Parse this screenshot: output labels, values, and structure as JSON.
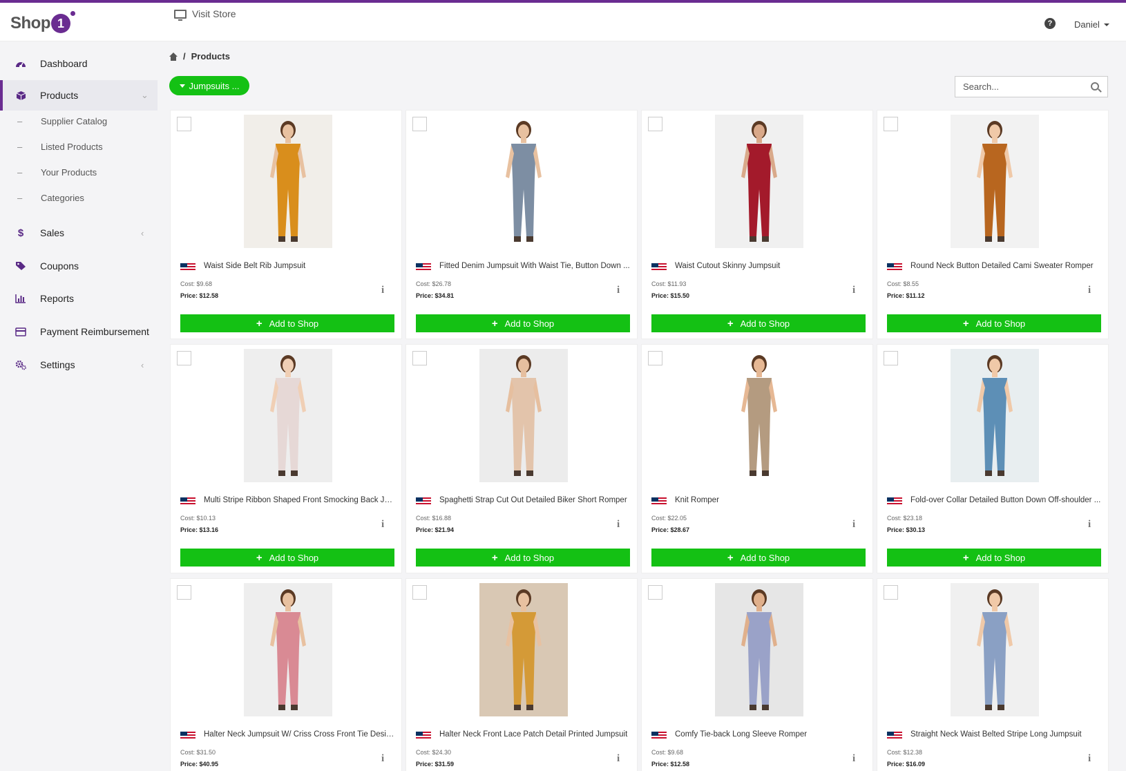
{
  "header": {
    "logo_text": "Shop",
    "logo_mark": "1",
    "visit_store": "Visit Store",
    "help": "?",
    "user": "Daniel"
  },
  "sidebar": {
    "items": [
      {
        "label": "Dashboard",
        "icon": "dashboard-icon"
      },
      {
        "label": "Products",
        "icon": "cube-icon",
        "active": true
      },
      {
        "label": "Sales",
        "icon": "dollar-icon"
      },
      {
        "label": "Coupons",
        "icon": "tag-icon"
      },
      {
        "label": "Reports",
        "icon": "bar-chart-icon"
      },
      {
        "label": "Payment Reimbursement",
        "icon": "credit-card-icon"
      },
      {
        "label": "Settings",
        "icon": "gears-icon"
      }
    ],
    "products_sub": [
      "Supplier Catalog",
      "Listed Products",
      "Your Products",
      "Categories"
    ]
  },
  "breadcrumb": {
    "separator": "/",
    "current": "Products"
  },
  "filter": {
    "label": "Jumpsuits ..."
  },
  "search": {
    "placeholder": "Search..."
  },
  "add_label": "Add to Shop",
  "info_glyph": "i",
  "colors": {
    "accent": "#6a2c91",
    "green": "#14c114"
  },
  "products": [
    {
      "name": "Waist Side Belt Rib Jumpsuit",
      "cost": "Cost: $9.68",
      "price": "Price: $12.58",
      "garment": "#d98e1c",
      "bg": "#f1eee9",
      "skin": "#e8c1a0"
    },
    {
      "name": "Fitted Denim Jumpsuit With Waist Tie, Button Down ...",
      "cost": "Cost: $26.78",
      "price": "Price: $34.81",
      "garment": "#7d8ea3",
      "bg": "#ffffff",
      "skin": "#e8c1a0"
    },
    {
      "name": "Waist Cutout Skinny Jumpsuit",
      "cost": "Cost: $11.93",
      "price": "Price: $15.50",
      "garment": "#a31a2b",
      "bg": "#f0f0f0",
      "skin": "#d9a98a"
    },
    {
      "name": "Round Neck Button Detailed Cami Sweater Romper",
      "cost": "Cost: $8.55",
      "price": "Price: $11.12",
      "garment": "#b8661f",
      "bg": "#f2f2f2",
      "skin": "#f0c9a8"
    },
    {
      "name": "Multi Stripe Ribbon Shaped Front Smocking Back Jum...",
      "cost": "Cost: $10.13",
      "price": "Price: $13.16",
      "garment": "#e6d8d6",
      "bg": "#eeeeee",
      "skin": "#f0cfb5"
    },
    {
      "name": "Spaghetti Strap Cut Out Detailed Biker Short Romper",
      "cost": "Cost: $16.88",
      "price": "Price: $21.94",
      "garment": "#e3c4ab",
      "bg": "#ececec",
      "skin": "#e6bf9f"
    },
    {
      "name": "Knit Romper",
      "cost": "Cost: $22.05",
      "price": "Price: $28.67",
      "garment": "#b49b80",
      "bg": "#ffffff",
      "skin": "#e6b894"
    },
    {
      "name": "Fold-over Collar Detailed Button Down Off-shoulder ...",
      "cost": "Cost: $23.18",
      "price": "Price: $30.13",
      "garment": "#5d8fb6",
      "bg": "#e8eef0",
      "skin": "#f0c9a8"
    },
    {
      "name": "Halter Neck Jumpsuit W/ Criss Cross Front Tie Designs",
      "cost": "Cost: $31.50",
      "price": "Price: $40.95",
      "garment": "#d98a94",
      "bg": "#eeeeee",
      "skin": "#e8c1a0"
    },
    {
      "name": "Halter Neck Front Lace Patch Detail Printed Jumpsuit",
      "cost": "Cost: $24.30",
      "price": "Price: $31.59",
      "garment": "#d49a37",
      "bg": "#d9c8b4",
      "skin": "#e8c1a0"
    },
    {
      "name": "Comfy Tie-back Long Sleeve Romper",
      "cost": "Cost: $9.68",
      "price": "Price: $12.58",
      "garment": "#9aa2c8",
      "bg": "#e6e6e6",
      "skin": "#e0b08c"
    },
    {
      "name": "Straight Neck Waist Belted Stripe Long Jumpsuit",
      "cost": "Cost: $12.38",
      "price": "Price: $16.09",
      "garment": "#8aa0c4",
      "bg": "#f0f0f0",
      "skin": "#f0c9a8"
    }
  ]
}
